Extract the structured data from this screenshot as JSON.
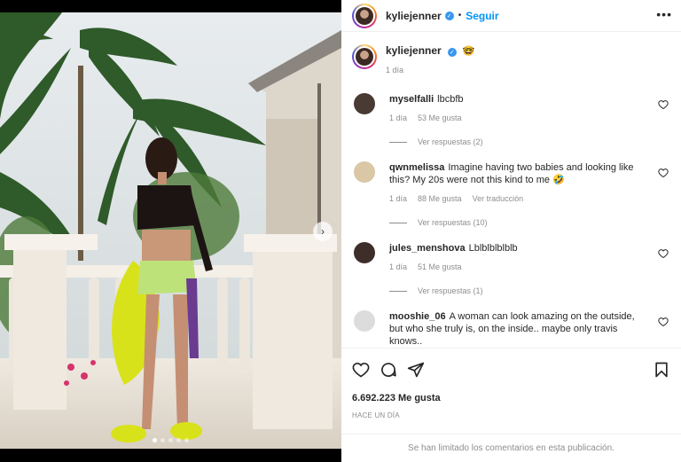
{
  "header": {
    "username": "kyliejenner",
    "bullet": "•",
    "follow_label": "Seguir",
    "more_glyph": "•••",
    "verified_icon": "verified-badge-icon"
  },
  "caption": {
    "username": "kyliejenner",
    "emoji": "🤓",
    "time": "1 día"
  },
  "comments": [
    {
      "username": "myselfalli",
      "text": "lbcbfb",
      "time": "1 día",
      "likes": "53 Me gusta",
      "translate": "",
      "replies": "Ver respuestas (2)",
      "avatar_color": "#4a3a34"
    },
    {
      "username": "qwnmelissa",
      "text": "Imagine having two babies and looking like this? My 20s were not this kind to me 🤣",
      "time": "1 día",
      "likes": "88 Me gusta",
      "translate": "Ver traducción",
      "replies": "Ver respuestas (10)",
      "avatar_color": "#d9c7a6"
    },
    {
      "username": "jules_menshova",
      "text": "Lblblblblblb",
      "time": "1 día",
      "likes": "51 Me gusta",
      "translate": "",
      "replies": "Ver respuestas (1)",
      "avatar_color": "#3e2e2a"
    },
    {
      "username": "mooshie_06",
      "text": "A woman can look amazing on the outside, but who she truly is, on the inside.. maybe only travis knows..",
      "time": "",
      "likes": "",
      "translate": "",
      "replies": "",
      "avatar_color": "#dcdcdc"
    }
  ],
  "post": {
    "likes": "6.692.223 Me gusta",
    "time_ago": "HACE UN DÍA"
  },
  "footer": {
    "notice": "Se han limitado los comentarios en esta publicación."
  },
  "media": {
    "next_glyph": "›",
    "slide_count": 5,
    "active_slide": 0
  },
  "colors": {
    "accent": "#0095f6",
    "verified": "#3897f0",
    "muted": "#8e8e8e",
    "text": "#262626"
  },
  "icons": [
    "heart-icon",
    "comment-icon",
    "share-icon",
    "bookmark-icon"
  ]
}
